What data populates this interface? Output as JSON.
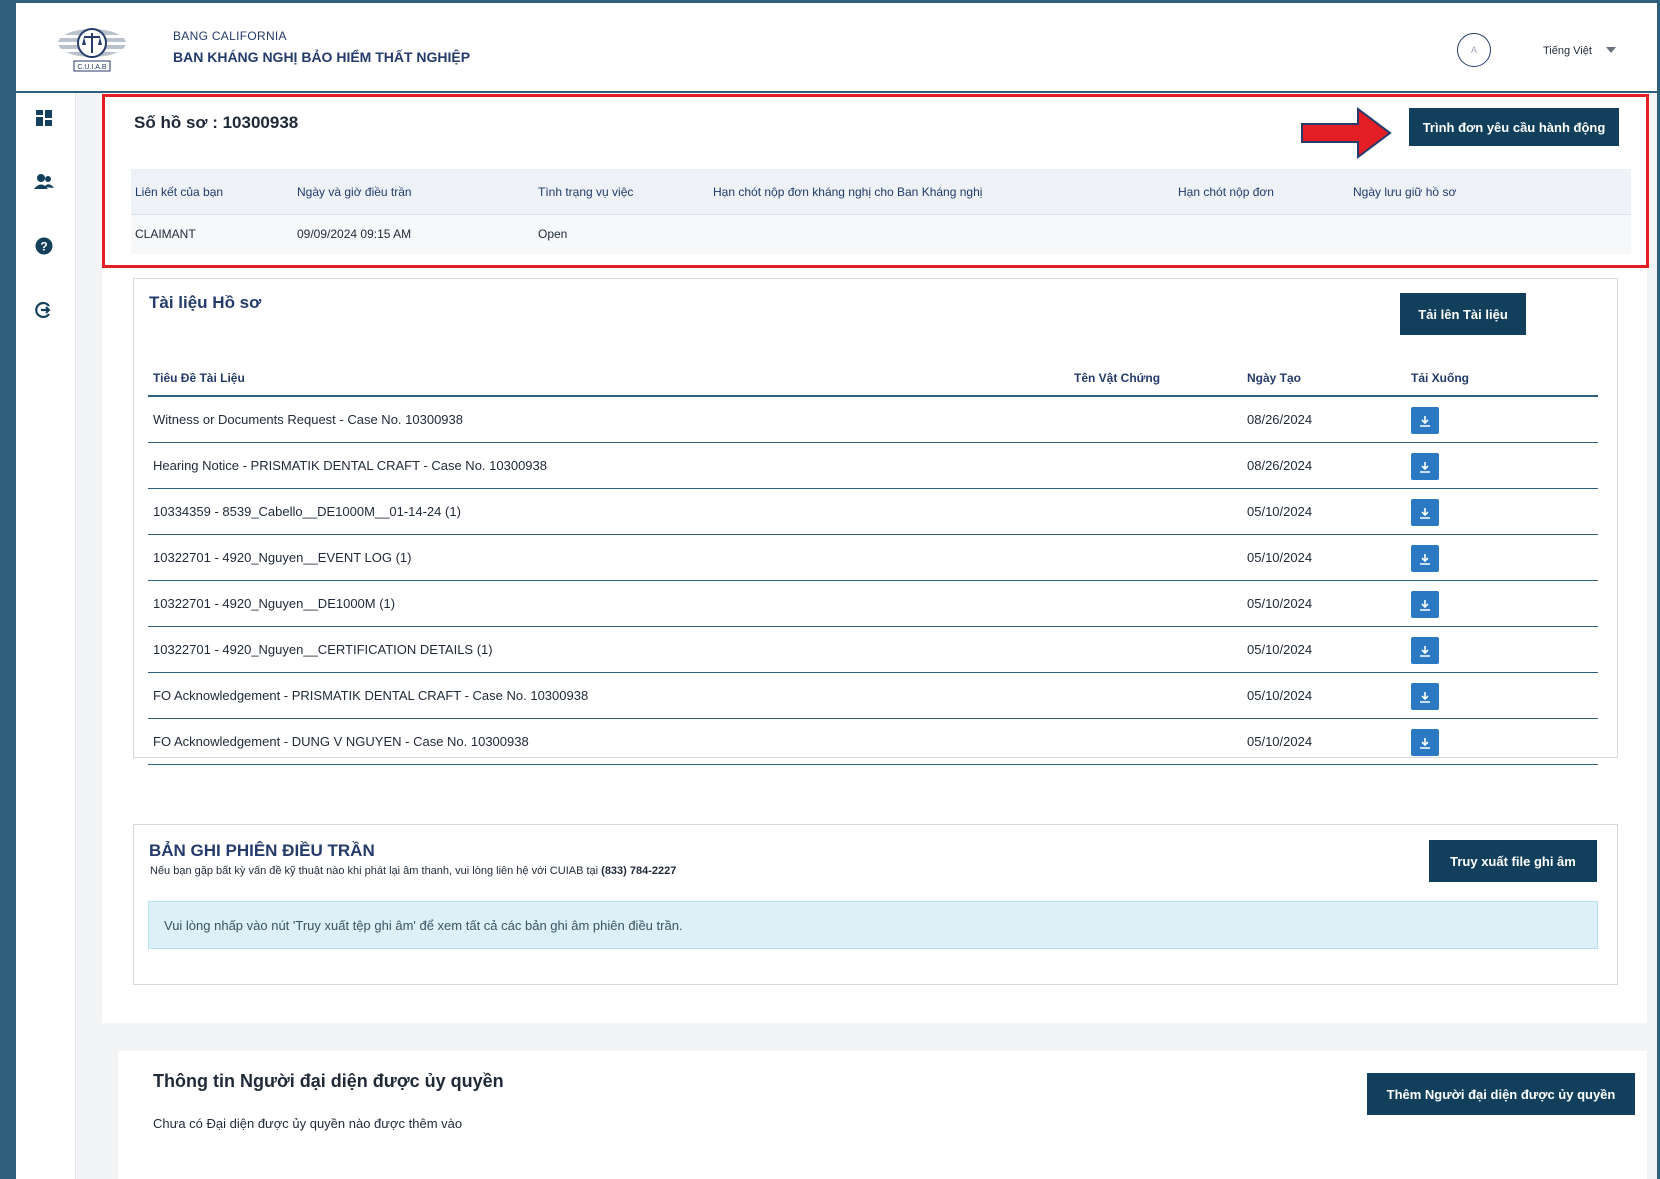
{
  "header": {
    "org_sub": "BANG CALIFORNIA",
    "org_title": "BAN KHÁNG NGHỊ BẢO HIỂM THẤT NGHIỆP",
    "logo_text": "C.U.I.A.B",
    "avatar_initial": "A",
    "language": "Tiếng Việt"
  },
  "sidebar": {
    "icons": [
      "dashboard-icon",
      "users-icon",
      "help-icon",
      "logout-icon"
    ]
  },
  "case": {
    "title": "Số hồ sơ : 10300938",
    "action_button": "Trình đơn yêu cầu hành động",
    "columns": [
      "Liên kết của bạn",
      "Ngày và giờ điều trần",
      "Tình trạng vụ việc",
      "Hạn chót nộp đơn kháng nghị cho Ban Kháng nghị",
      "Hạn chót nộp đơn",
      "Ngày lưu giữ hồ sơ"
    ],
    "row": [
      "CLAIMANT",
      "09/09/2024 09:15 AM",
      "Open",
      "",
      "",
      ""
    ]
  },
  "documents": {
    "title": "Tài liệu Hồ sơ",
    "upload_button": "Tải lên Tài liệu",
    "columns": [
      "Tiêu Đề Tài Liệu",
      "Tên Vật Chứng",
      "Ngày Tạo",
      "Tải Xuống"
    ],
    "rows": [
      {
        "title": "Witness or Documents Request - Case No. 10300938",
        "exhibit": "",
        "date": "08/26/2024"
      },
      {
        "title": "Hearing Notice - PRISMATIK DENTAL CRAFT - Case No. 10300938",
        "exhibit": "",
        "date": "08/26/2024"
      },
      {
        "title": "10334359 - 8539_Cabello__DE1000M__01-14-24 (1)",
        "exhibit": "",
        "date": "05/10/2024"
      },
      {
        "title": "10322701 - 4920_Nguyen__EVENT LOG (1)",
        "exhibit": "",
        "date": "05/10/2024"
      },
      {
        "title": "10322701 - 4920_Nguyen__DE1000M (1)",
        "exhibit": "",
        "date": "05/10/2024"
      },
      {
        "title": "10322701 - 4920_Nguyen__CERTIFICATION DETAILS (1)",
        "exhibit": "",
        "date": "05/10/2024"
      },
      {
        "title": "FO Acknowledgement - PRISMATIK DENTAL CRAFT - Case No. 10300938",
        "exhibit": "",
        "date": "05/10/2024"
      },
      {
        "title": "FO Acknowledgement - DUNG V NGUYEN - Case No. 10300938",
        "exhibit": "",
        "date": "05/10/2024"
      }
    ]
  },
  "recording": {
    "title": "BẢN GHI PHIÊN ĐIỀU TRẦN",
    "note_prefix": "Nếu bạn gặp bất kỳ vấn đề kỹ thuật nào khi phát lại âm thanh, vui lòng liên hệ với CUIAB tại ",
    "note_phone": "(833) 784-2227",
    "button": "Truy xuất file ghi âm",
    "info": "Vui lòng nhấp vào nút 'Truy xuất tệp ghi âm' để xem tất cả các bản ghi âm phiên điều trần."
  },
  "representative": {
    "title": "Thông tin Người đại diện được ủy quyền",
    "button": "Thêm Người đại diện được ủy quyền",
    "note": "Chưa có Đại diện được ủy quyền nào được thêm vào"
  },
  "colors": {
    "brand_dark": "#12405c",
    "frame": "#2f5f7a",
    "highlight": "#e31e24",
    "download": "#2b79c2"
  }
}
